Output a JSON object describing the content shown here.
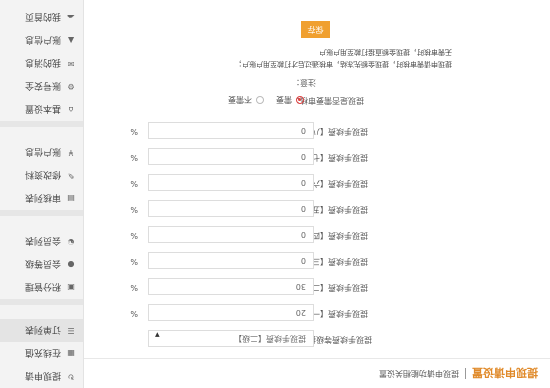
{
  "page": {
    "title": "提现申请设置",
    "subtitle": "提现申请功能相关设置"
  },
  "sidebar": {
    "groups": [
      {
        "items": [
          {
            "label": "提现申请",
            "icon": "sync-icon"
          },
          {
            "label": "在线充值",
            "icon": "grid-icon"
          },
          {
            "label": "订单列表",
            "icon": "list-icon"
          }
        ]
      },
      {
        "items": [
          {
            "label": "积分管理",
            "icon": "card-icon"
          },
          {
            "label": "会员等级",
            "icon": "user-icon"
          },
          {
            "label": "会员列表",
            "icon": "person-icon"
          }
        ]
      },
      {
        "items": [
          {
            "label": "审核列表",
            "icon": "doc-icon"
          },
          {
            "label": "修改资料",
            "icon": "edit-icon"
          },
          {
            "label": "账户信息",
            "icon": "yen-icon"
          }
        ]
      },
      {
        "items": [
          {
            "label": "基本设置",
            "icon": "home-icon"
          },
          {
            "label": "账号安全",
            "icon": "gear-icon"
          },
          {
            "label": "我的消息",
            "icon": "mail-icon"
          },
          {
            "label": "账户信息",
            "icon": "shield-icon"
          },
          {
            "label": "我的首页",
            "icon": "cloud-icon"
          }
        ]
      }
    ]
  },
  "form": {
    "rows": [
      {
        "label": "提现手续费【一级】：",
        "value": "20",
        "unit": "%"
      },
      {
        "label": "提现手续费【二级】：",
        "value": "30",
        "unit": "%"
      },
      {
        "label": "提现手续费【三级】：",
        "value": "0",
        "unit": "%"
      },
      {
        "label": "提现手续费【四级】：",
        "value": "0",
        "unit": "%"
      },
      {
        "label": "提现手续费【五级】：",
        "value": "0",
        "unit": "%"
      },
      {
        "label": "提现手续费【六级】：",
        "value": "0",
        "unit": "%"
      },
      {
        "label": "提现手续费【七级】：",
        "value": "0",
        "unit": "%"
      },
      {
        "label": "提现手续费【八级】：",
        "value": "0",
        "unit": "%"
      }
    ],
    "level_select": {
      "label": "提现手续费等级扣除：",
      "value": "提现手续费【二级】"
    },
    "audit": {
      "label": "提现是否需要审核：",
      "options": [
        "需要",
        "不需要"
      ],
      "selected": "需要"
    },
    "notes": {
      "label": "注意：",
      "lines": [
        "提现申请需审核时，提现金额先冻结，审核通过后才打款至用户账户；",
        "无需审核时，提现金额直接打款至用户账户"
      ]
    },
    "save_label": "保存"
  },
  "colors": {
    "accent": "#f0a030",
    "title": "#e08a2a",
    "radio_active": "#e04040"
  }
}
